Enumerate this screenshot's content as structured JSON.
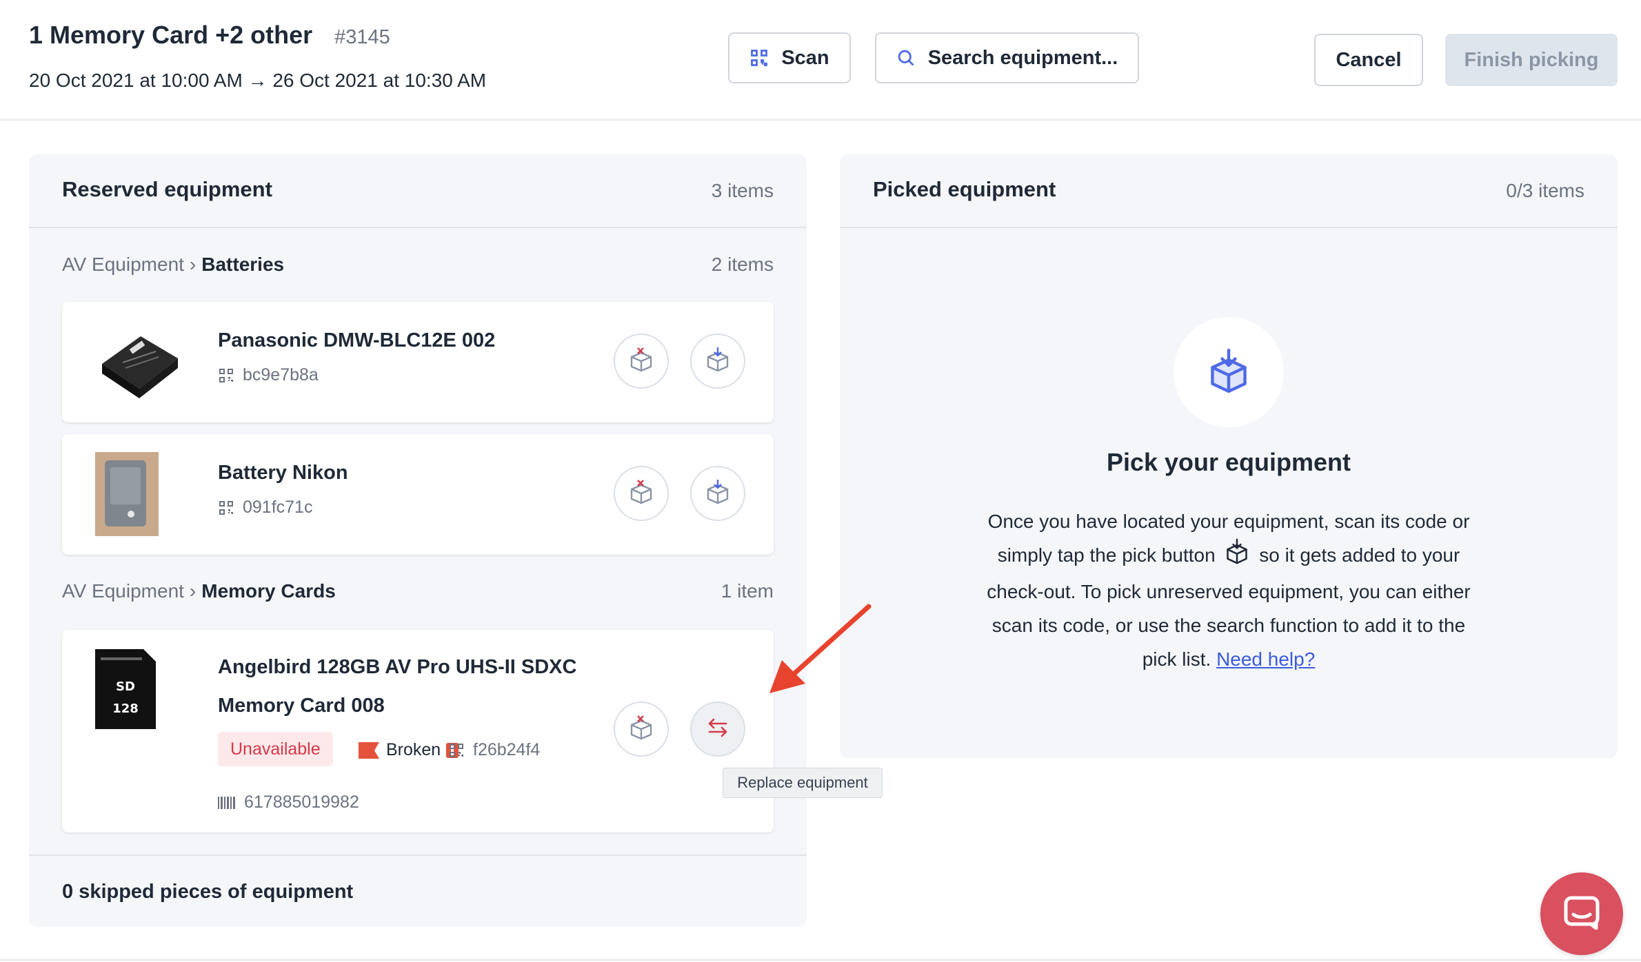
{
  "header": {
    "title": "1 Memory Card +2 other",
    "order_number": "#3145",
    "dates": "20 Oct 2021 at 10:00 AM → 26 Oct 2021 at 10:30 AM",
    "scan_label": "Scan",
    "search_label": "Search equipment...",
    "cancel_label": "Cancel",
    "finish_label": "Finish picking"
  },
  "reserved": {
    "title": "Reserved equipment",
    "count": "3 items",
    "groups": [
      {
        "parent": "AV Equipment",
        "separator": "›",
        "name": "Batteries",
        "count": "2 items",
        "items": [
          {
            "name": "Panasonic DMW-BLC12E 002",
            "code": "bc9e7b8a"
          },
          {
            "name": "Battery Nikon",
            "code": "091fc71c"
          }
        ]
      },
      {
        "parent": "AV Equipment",
        "separator": "›",
        "name": "Memory Cards",
        "count": "1 item",
        "items": [
          {
            "name_line1": "Angelbird 128GB AV Pro UHS-II SDXC",
            "name_line2": "Memory Card 008",
            "status": "Unavailable",
            "flag": "Broken",
            "code": "f26b24f4",
            "barcode": "617885019982"
          }
        ]
      }
    ],
    "skipped": "0 skipped pieces of equipment"
  },
  "picked": {
    "title": "Picked equipment",
    "count": "0/3 items",
    "empty_title": "Pick your equipment",
    "empty_text_1": "Once you have located your equipment, scan its code or simply tap the pick button",
    "empty_text_2": "so it gets added to your check-out. To pick unreserved equipment, you can either scan its code, or use the search function to add it to the pick list.",
    "help_link": "Need help?"
  },
  "tooltip": "Replace equipment",
  "colors": {
    "accent": "#4f6ae6",
    "danger": "#d33a4a",
    "chat": "#d9505f",
    "panel_bg": "#f4f6f9"
  },
  "icons": [
    "qr-scan-icon",
    "search-icon",
    "unpick-box-icon",
    "pick-box-icon",
    "replace-icon",
    "qr-code-icon",
    "barcode-icon",
    "flag-icon",
    "chat-icon"
  ]
}
